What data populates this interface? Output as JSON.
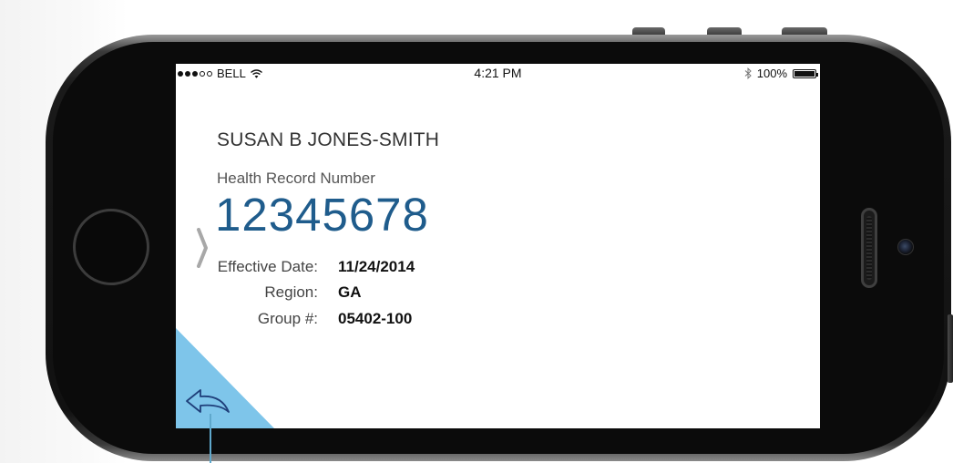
{
  "status_bar": {
    "carrier": "BELL",
    "time": "4:21 PM",
    "battery": "100%",
    "battery_level": 1.0,
    "signal_strength": 3,
    "signal_max": 5
  },
  "card": {
    "member_name": "SUSAN B JONES-SMITH",
    "record_label": "Health Record Number",
    "record_number": "12345678",
    "details": [
      {
        "label": "Effective Date:",
        "value": "11/24/2014"
      },
      {
        "label": "Region:",
        "value": "GA"
      },
      {
        "label": "Group #:",
        "value": "05402-100"
      }
    ]
  },
  "icons": {
    "wifi": "wifi-icon",
    "bluetooth": "bluetooth-icon",
    "battery": "battery-icon",
    "back": "back-arrow-icon",
    "chevron": "chevron-left-icon"
  },
  "colors": {
    "record_number": "#1f5c8c",
    "corner_triangle": "#7ec5ea",
    "arrow_stroke": "#1f3f7a",
    "phone_body": "#111111"
  }
}
